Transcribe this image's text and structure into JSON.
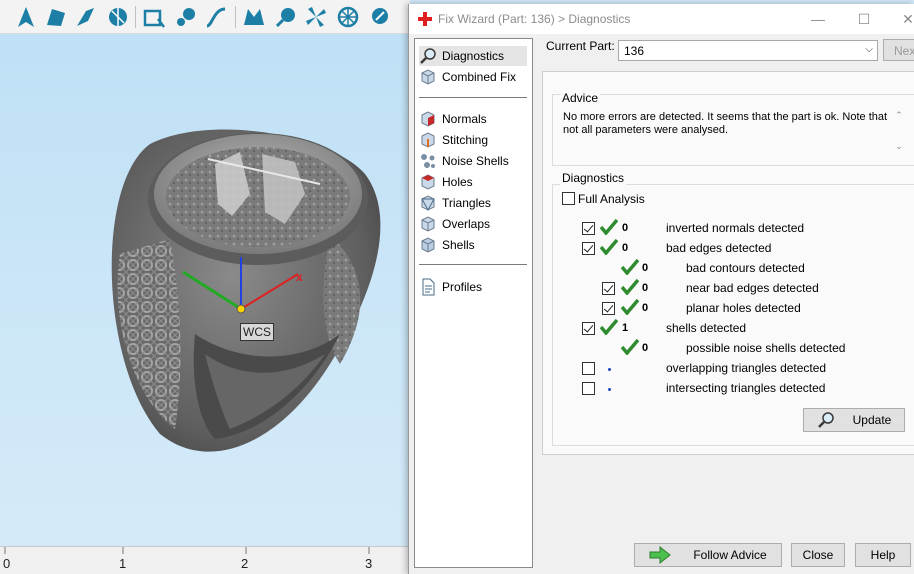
{
  "dialog": {
    "title": "Fix Wizard (Part: 136) > Diagnostics",
    "controls": {
      "minimize": "—",
      "maximize": "☐",
      "close": "✕"
    }
  },
  "nav": {
    "items": [
      {
        "label": "Diagnostics",
        "icon": "magnifier-icon",
        "selected": true
      },
      {
        "label": "Combined Fix",
        "icon": "cube-icon"
      },
      {
        "label": "Normals",
        "icon": "normals-cube-icon"
      },
      {
        "label": "Stitching",
        "icon": "stitching-cube-icon"
      },
      {
        "label": "Noise Shells",
        "icon": "noise-shells-icon"
      },
      {
        "label": "Holes",
        "icon": "holes-cube-icon"
      },
      {
        "label": "Triangles",
        "icon": "triangles-cube-icon"
      },
      {
        "label": "Overlaps",
        "icon": "overlaps-cube-icon"
      },
      {
        "label": "Shells",
        "icon": "shells-cube-icon"
      },
      {
        "label": "Profiles",
        "icon": "document-icon"
      }
    ]
  },
  "current_part": {
    "label": "Current Part:",
    "value": "136",
    "next_label": "Next"
  },
  "advice": {
    "title": "Advice",
    "text": "No more errors are detected. It seems that the part is ok. Note that not all parameters were analysed."
  },
  "diagnostics": {
    "title": "Diagnostics",
    "full_analysis": {
      "label": "Full Analysis",
      "checked": false
    },
    "rows": [
      {
        "checkbox": true,
        "checked": true,
        "status": "ok",
        "count": "0",
        "label": "inverted normals detected"
      },
      {
        "checkbox": true,
        "checked": true,
        "status": "ok",
        "count": "0",
        "label": "bad edges detected"
      },
      {
        "checkbox": false,
        "status": "ok",
        "count": "0",
        "label": "bad contours detected"
      },
      {
        "checkbox": true,
        "checked": true,
        "status": "ok",
        "count": "0",
        "label": "near bad edges detected"
      },
      {
        "checkbox": true,
        "checked": true,
        "status": "ok",
        "count": "0",
        "label": "planar holes detected"
      },
      {
        "checkbox": true,
        "checked": true,
        "status": "ok",
        "count": "1",
        "label": "shells detected"
      },
      {
        "checkbox": false,
        "status": "ok",
        "count": "0",
        "label": "possible noise shells detected"
      },
      {
        "checkbox": true,
        "checked": false,
        "status": "unknown",
        "count": "",
        "label": "overlapping triangles detected"
      },
      {
        "checkbox": true,
        "checked": false,
        "status": "unknown",
        "count": "",
        "label": "intersecting triangles detected"
      }
    ],
    "update_label": "Update"
  },
  "footer": {
    "follow_advice": "Follow Advice",
    "close": "Close",
    "help": "Help"
  },
  "viewport": {
    "wcs_label": "WCS",
    "axis_x_label": "x",
    "ruler_labels": [
      "0",
      "1",
      "2",
      "3"
    ]
  },
  "colors": {
    "accent_green": "#2e8b2e",
    "viewport_bg": "#cbe5f7",
    "axis_x": "#e02020",
    "axis_y": "#22aa22",
    "axis_z": "#2040e0"
  }
}
